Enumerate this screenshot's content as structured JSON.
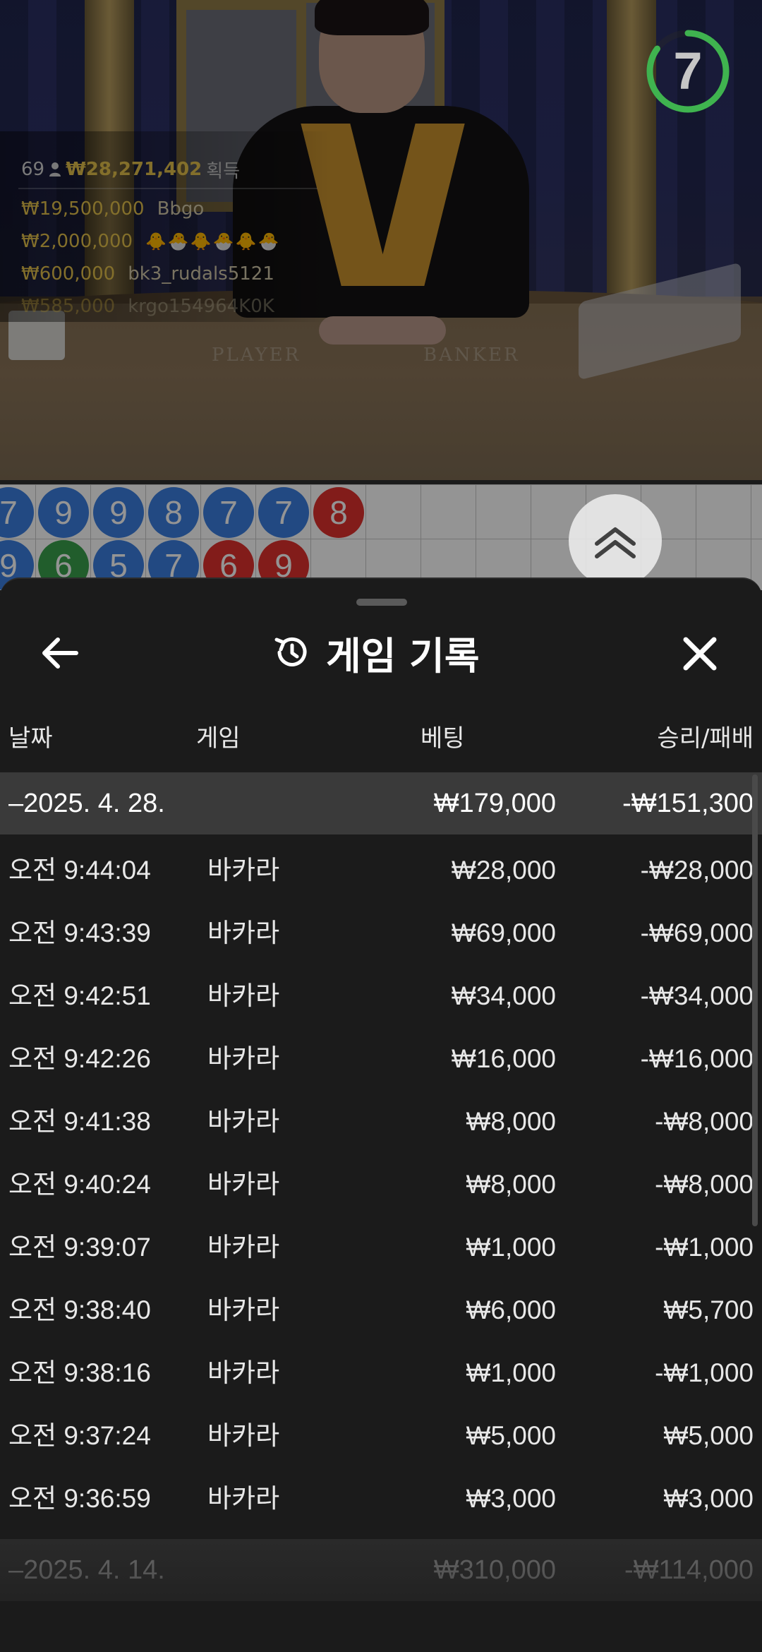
{
  "live": {
    "timer": "7",
    "timer_progress": 0.85,
    "winners": {
      "count": "69",
      "total": "₩28,271,402",
      "suffix": "획득",
      "rows": [
        {
          "amount": "₩19,500,000",
          "name": "Bbgo"
        },
        {
          "amount": "₩2,000,000",
          "name": "🐥🐣🐥🐣🐥🐣"
        },
        {
          "amount": "₩600,000",
          "name": "bk3_rudals5121"
        },
        {
          "amount": "₩585,000",
          "name": "krgo154964K0K"
        }
      ]
    },
    "table_labels": {
      "player": "PLAYER",
      "banker": "BANKER"
    },
    "bead_road": {
      "row1": [
        {
          "n": "7",
          "c": "b"
        },
        {
          "n": "9",
          "c": "b"
        },
        {
          "n": "9",
          "c": "b"
        },
        {
          "n": "8",
          "c": "b"
        },
        {
          "n": "7",
          "c": "b"
        },
        {
          "n": "7",
          "c": "b"
        },
        {
          "n": "8",
          "c": "r"
        }
      ],
      "row2": [
        {
          "n": "9",
          "c": "b"
        },
        {
          "n": "6",
          "c": "g"
        },
        {
          "n": "5",
          "c": "b"
        },
        {
          "n": "7",
          "c": "b"
        },
        {
          "n": "6",
          "c": "r"
        },
        {
          "n": "9",
          "c": "r"
        }
      ]
    }
  },
  "sheet": {
    "title": "게임 기록",
    "columns": {
      "date": "날짜",
      "game": "게임",
      "bet": "베팅",
      "result": "승리/패배"
    },
    "groups": [
      {
        "date": "–2025. 4. 28.",
        "bet": "₩179,000",
        "result": "-₩151,300"
      },
      {
        "date": "–2025. 4. 14.",
        "bet": "₩310,000",
        "result": "-₩114,000"
      }
    ],
    "rows": [
      {
        "time": "오전 9:44:04",
        "game": "바카라",
        "bet": "₩28,000",
        "result": "-₩28,000"
      },
      {
        "time": "오전 9:43:39",
        "game": "바카라",
        "bet": "₩69,000",
        "result": "-₩69,000"
      },
      {
        "time": "오전 9:42:51",
        "game": "바카라",
        "bet": "₩34,000",
        "result": "-₩34,000"
      },
      {
        "time": "오전 9:42:26",
        "game": "바카라",
        "bet": "₩16,000",
        "result": "-₩16,000"
      },
      {
        "time": "오전 9:41:38",
        "game": "바카라",
        "bet": "₩8,000",
        "result": "-₩8,000"
      },
      {
        "time": "오전 9:40:24",
        "game": "바카라",
        "bet": "₩8,000",
        "result": "-₩8,000"
      },
      {
        "time": "오전 9:39:07",
        "game": "바카라",
        "bet": "₩1,000",
        "result": "-₩1,000"
      },
      {
        "time": "오전 9:38:40",
        "game": "바카라",
        "bet": "₩6,000",
        "result": "₩5,700"
      },
      {
        "time": "오전 9:38:16",
        "game": "바카라",
        "bet": "₩1,000",
        "result": "-₩1,000"
      },
      {
        "time": "오전 9:37:24",
        "game": "바카라",
        "bet": "₩5,000",
        "result": "₩5,000"
      },
      {
        "time": "오전 9:36:59",
        "game": "바카라",
        "bet": "₩3,000",
        "result": "₩3,000"
      }
    ]
  },
  "colors": {
    "accent_gold": "#e2c04a",
    "timer_green": "#3fb34f",
    "banker_red": "#e0312e",
    "player_blue": "#3b7fe0",
    "tie_green": "#3aa14d"
  }
}
